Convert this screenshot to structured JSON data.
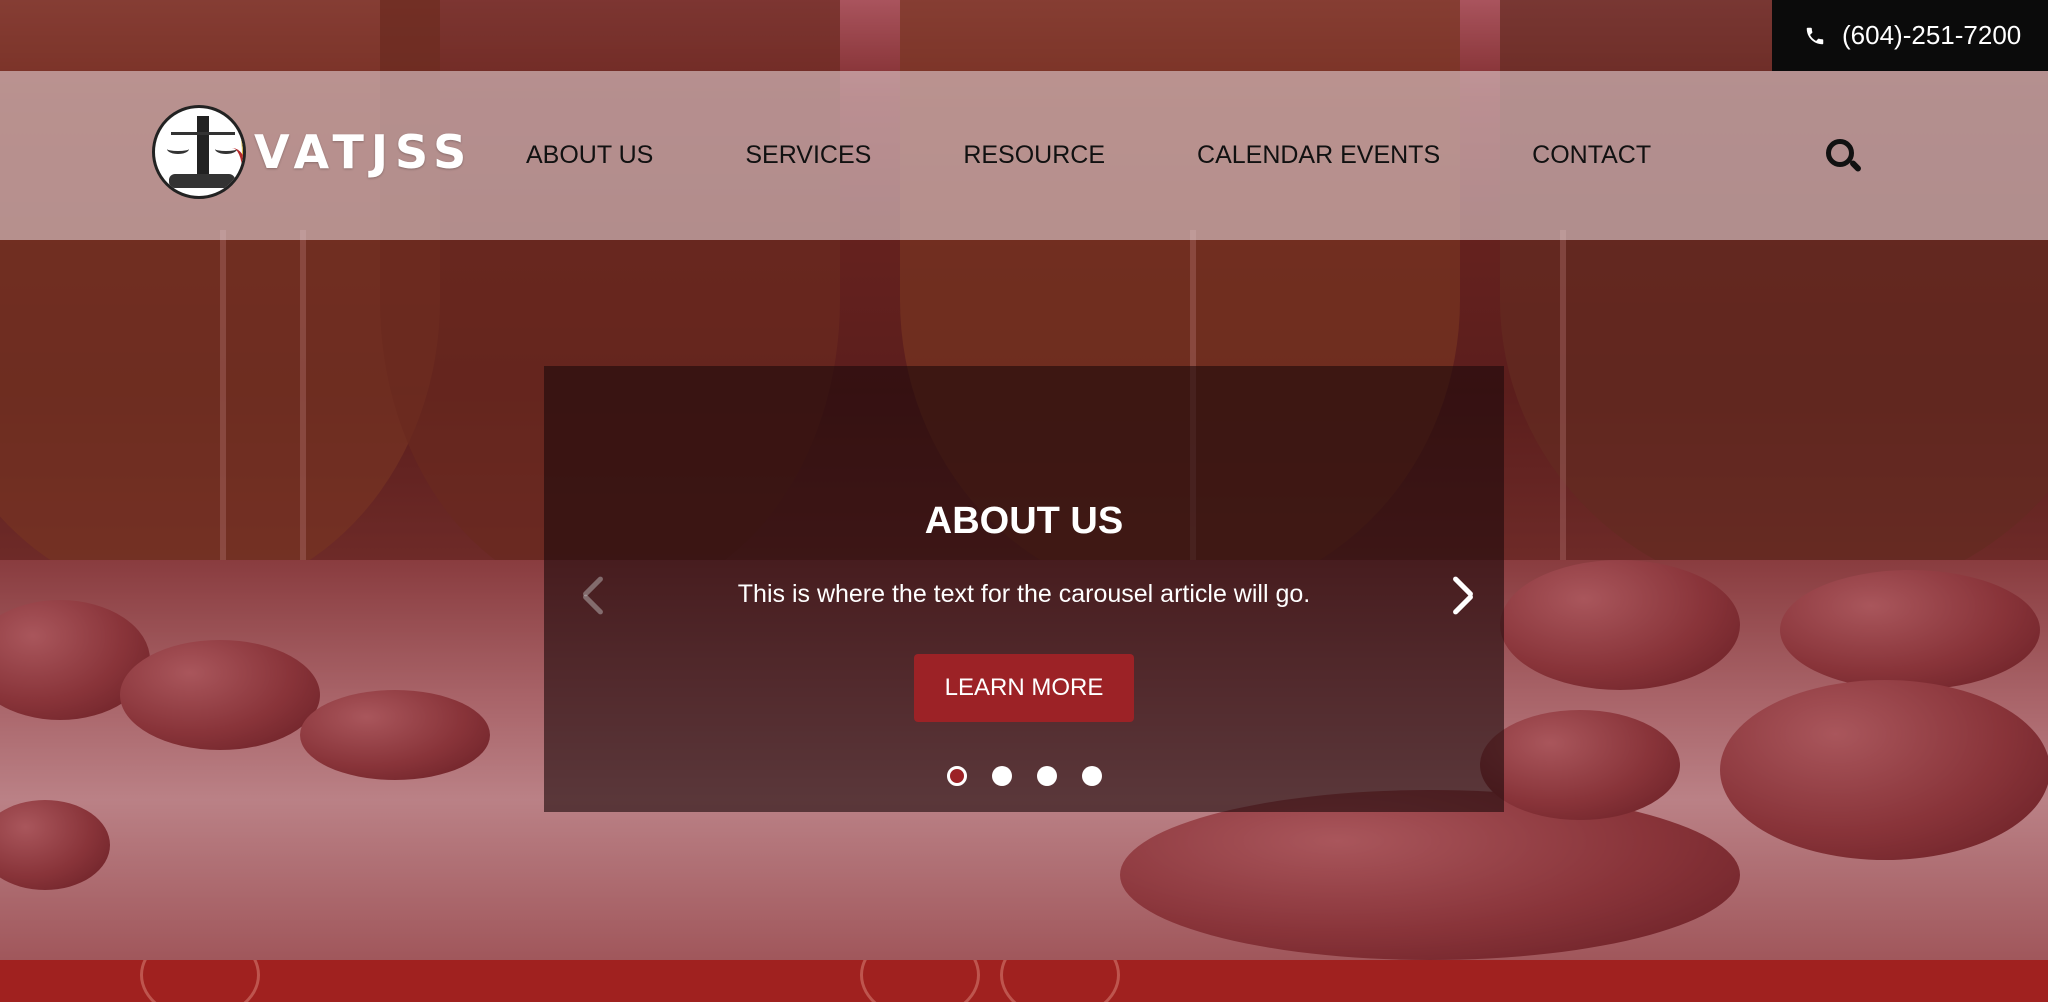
{
  "phone": {
    "number": "(604)-251-7200",
    "icon": "phone-icon"
  },
  "logo": {
    "text": "VATJSS",
    "icon": "justice-scale-logo-icon"
  },
  "nav": {
    "items": [
      {
        "label": "ABOUT US"
      },
      {
        "label": "SERVICES"
      },
      {
        "label": "RESOURCE"
      },
      {
        "label": "CALENDAR EVENTS"
      },
      {
        "label": "CONTACT"
      }
    ],
    "search_icon": "search-icon"
  },
  "carousel": {
    "title": "ABOUT US",
    "text": "This is where the text for the carousel article will go.",
    "button_label": "LEARN MORE",
    "prev_icon": "chevron-left-icon",
    "next_icon": "chevron-right-icon",
    "slide_count": 4,
    "active_slide": 1
  },
  "colors": {
    "brand_red": "#9c2226",
    "phone_bar": "#0b0b0b",
    "header_bg": "rgba(225,205,208,0.62)"
  }
}
